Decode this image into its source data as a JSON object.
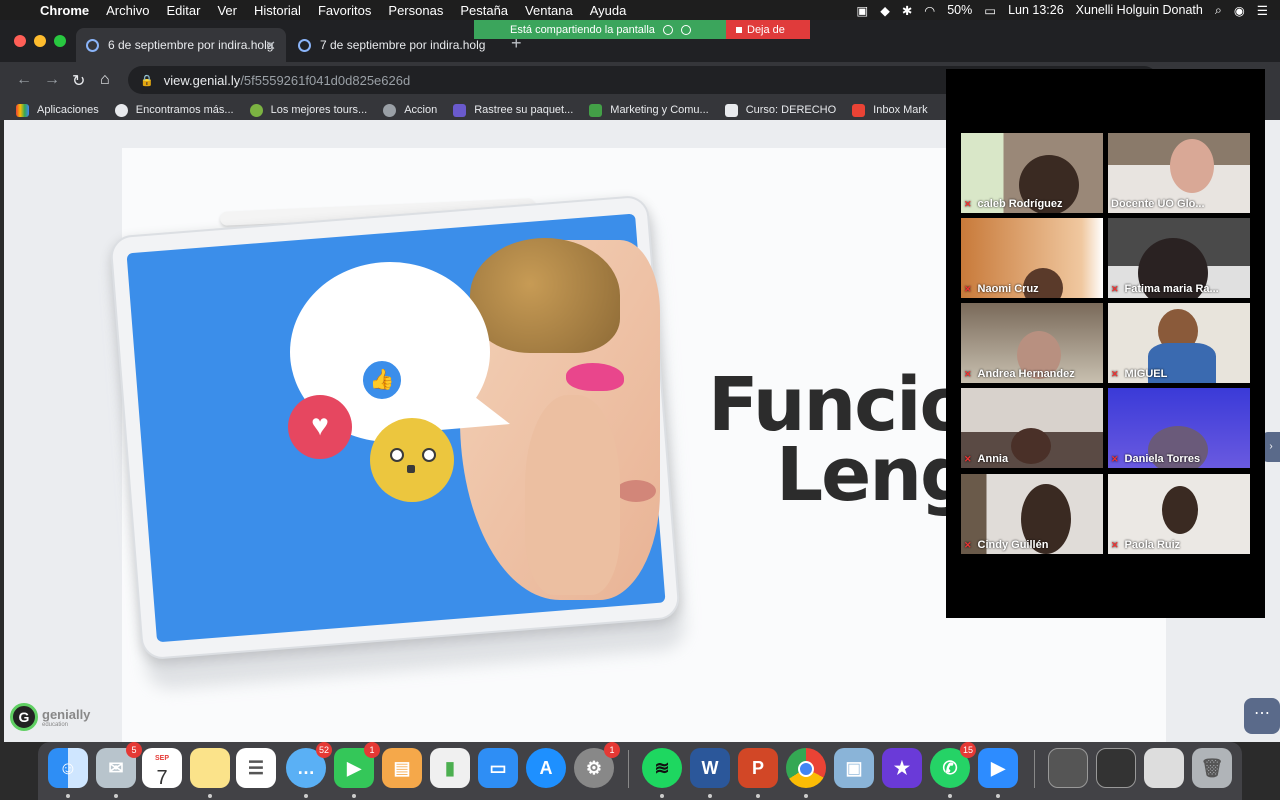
{
  "menubar": {
    "app": "Chrome",
    "items": [
      "Archivo",
      "Editar",
      "Ver",
      "Historial",
      "Favoritos",
      "Personas",
      "Pestaña",
      "Ventana",
      "Ayuda"
    ],
    "battery": "50%",
    "datetime": "Lun 13:26",
    "user": "Xunelli Holguin Donath"
  },
  "share_banner": {
    "status": "Está compartiendo la pantalla",
    "stop_label": "Deja de"
  },
  "tabs": [
    {
      "label": "6 de septiembre por indira.holg"
    },
    {
      "label": "7 de septiembre por indira.holg"
    }
  ],
  "address": {
    "host": "view.genial.ly",
    "path": "/5f5559261f041d0d825e626d"
  },
  "bookmarks": [
    {
      "label": "Aplicaciones",
      "icon": "grid-icon"
    },
    {
      "label": "Encontramos más...",
      "icon": "globe-icon"
    },
    {
      "label": "Los mejores tours...",
      "icon": "tour-icon"
    },
    {
      "label": "Accion",
      "icon": "accion-icon"
    },
    {
      "label": "Rastree su paquet...",
      "icon": "package-icon"
    },
    {
      "label": "Marketing y Comu...",
      "icon": "marketing-icon"
    },
    {
      "label": "Curso: DERECHO",
      "icon": "course-icon"
    },
    {
      "label": "Inbox Mark",
      "icon": "gmail-icon"
    }
  ],
  "slide": {
    "title_line1": "Funcion",
    "title_line2": "Lengu",
    "brand": "genially",
    "brand_sub": "education"
  },
  "participants": [
    {
      "name": "caleb Rodríguez"
    },
    {
      "name": "Docente UO Glo..."
    },
    {
      "name": "Naomi Cruz"
    },
    {
      "name": "Fatima maria Ra..."
    },
    {
      "name": "Andrea Hernandez"
    },
    {
      "name": "MIGUEL"
    },
    {
      "name": "Annia"
    },
    {
      "name": "Daniela Torres"
    },
    {
      "name": "Cindy Guillén"
    },
    {
      "name": "Paola Ruiz"
    }
  ],
  "dock": {
    "mail_badge": "5",
    "calendar_month": "SEP",
    "calendar_day": "7",
    "messages_badge": "52",
    "facetime_badge": "1",
    "prefs_badge": "1",
    "whatsapp_badge": "15"
  }
}
